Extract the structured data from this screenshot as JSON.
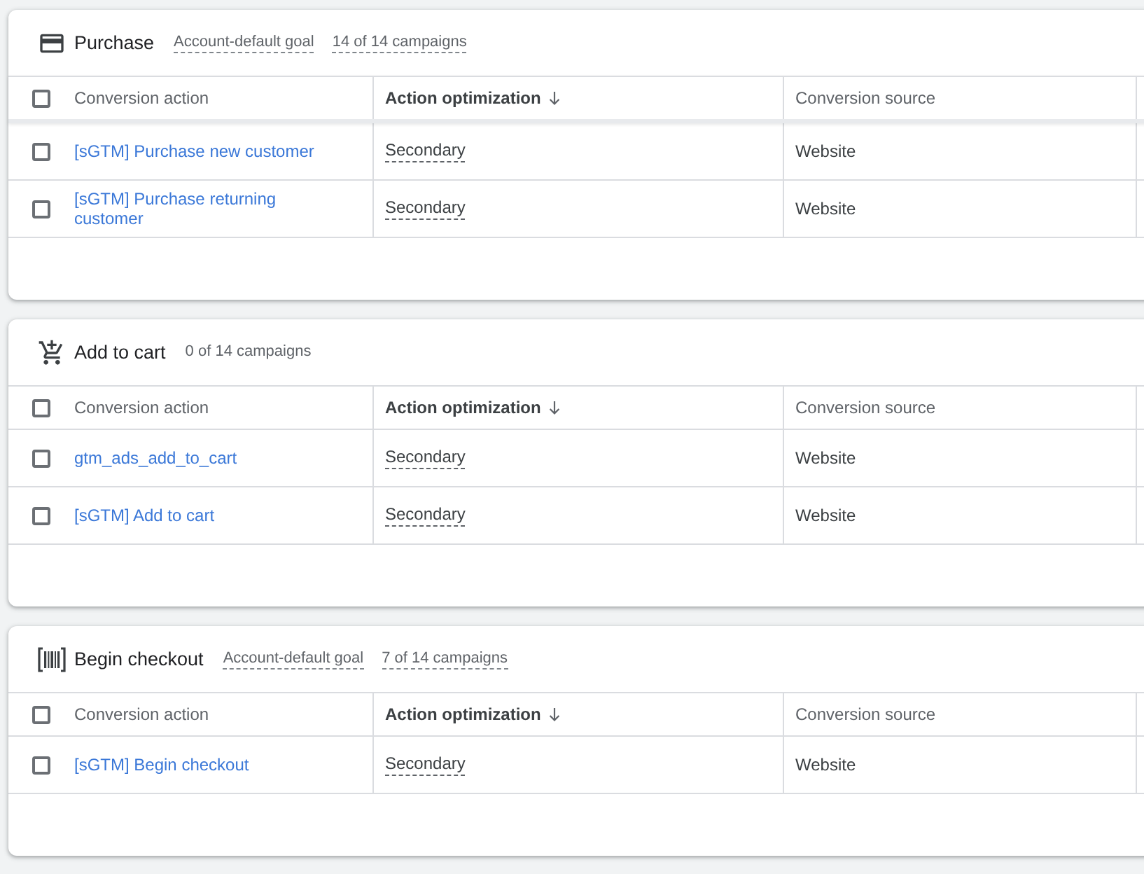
{
  "sections": [
    {
      "kind": "purchase",
      "title": "Purchase",
      "tags": [
        {
          "text": "Account-default goal",
          "underlined": true
        },
        {
          "text": "14 of 14 campaigns",
          "underlined": true
        }
      ],
      "header_raised": true,
      "select_all_checked": false,
      "columns": [
        {
          "label": "Conversion action",
          "sorted": false
        },
        {
          "label": "Action optimization",
          "sorted": true
        },
        {
          "label": "Conversion source",
          "sorted": false
        }
      ],
      "rows": [
        {
          "checked": false,
          "action": "[sGTM] Purchase new customer",
          "optimization": "Secondary",
          "source": "Website"
        },
        {
          "checked": false,
          "action": "[sGTM] Purchase returning customer",
          "optimization": "Secondary",
          "source": "Website"
        }
      ]
    },
    {
      "kind": "cart",
      "title": "Add to cart",
      "tags": [
        {
          "text": "0 of 14 campaigns",
          "underlined": false
        }
      ],
      "header_raised": false,
      "select_all_checked": false,
      "columns": [
        {
          "label": "Conversion action",
          "sorted": false
        },
        {
          "label": "Action optimization",
          "sorted": true
        },
        {
          "label": "Conversion source",
          "sorted": false
        }
      ],
      "rows": [
        {
          "checked": false,
          "action": "gtm_ads_add_to_cart",
          "optimization": "Secondary",
          "source": "Website"
        },
        {
          "checked": false,
          "action": "[sGTM] Add to cart",
          "optimization": "Secondary",
          "source": "Website"
        }
      ]
    },
    {
      "kind": "checkout",
      "title": "Begin checkout",
      "tags": [
        {
          "text": "Account-default goal",
          "underlined": true
        },
        {
          "text": "7 of 14 campaigns",
          "underlined": true
        }
      ],
      "header_raised": false,
      "select_all_checked": false,
      "columns": [
        {
          "label": "Conversion action",
          "sorted": false
        },
        {
          "label": "Action optimization",
          "sorted": true
        },
        {
          "label": "Conversion source",
          "sorted": false
        }
      ],
      "rows": [
        {
          "checked": false,
          "action": "[sGTM] Begin checkout",
          "optimization": "Secondary",
          "source": "Website"
        }
      ]
    }
  ]
}
